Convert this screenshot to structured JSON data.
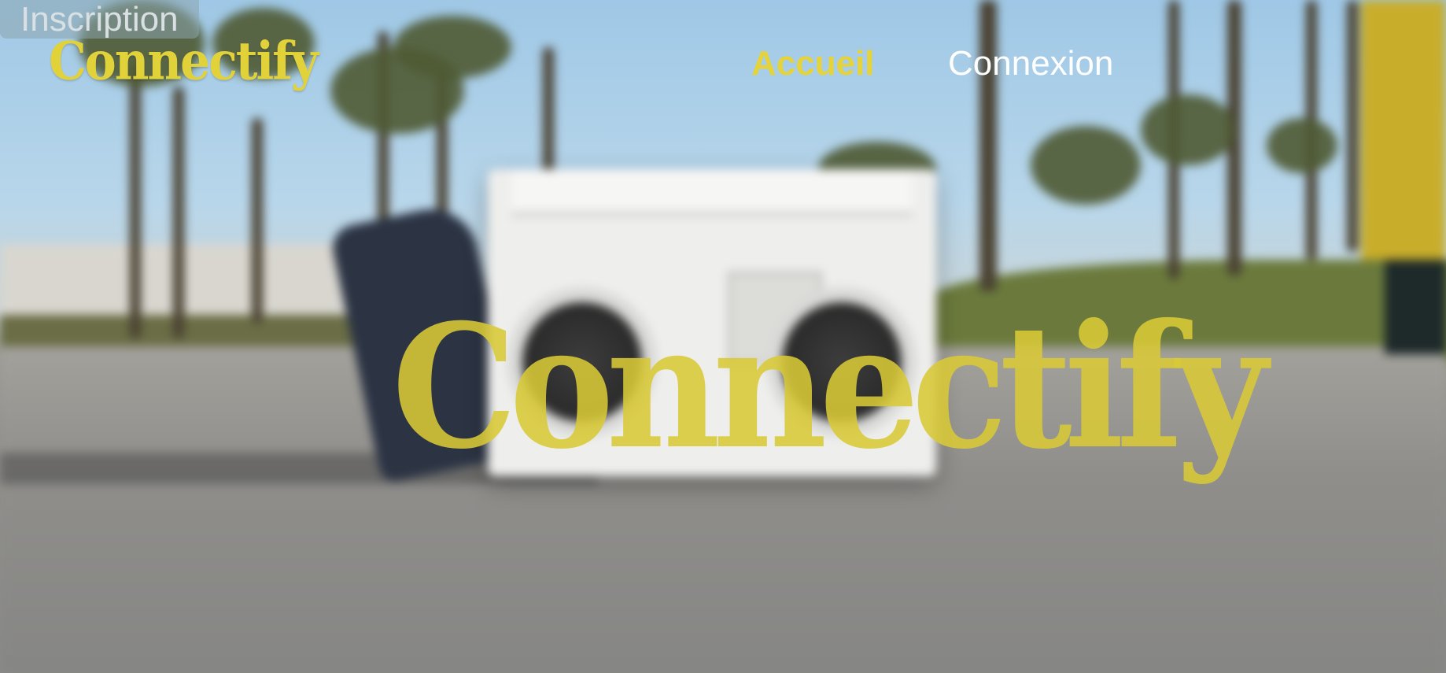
{
  "header": {
    "logo_text": "Connectify",
    "nav": [
      {
        "label": "Accueil",
        "active": true
      },
      {
        "label": "Connexion",
        "active": false
      },
      {
        "label": "Inscription",
        "active": false
      }
    ]
  },
  "hero": {
    "title": "Connectify"
  },
  "colors": {
    "accent": "#e2d23a",
    "nav_text": "#ffffff",
    "button_bg": "#8ca5af"
  }
}
